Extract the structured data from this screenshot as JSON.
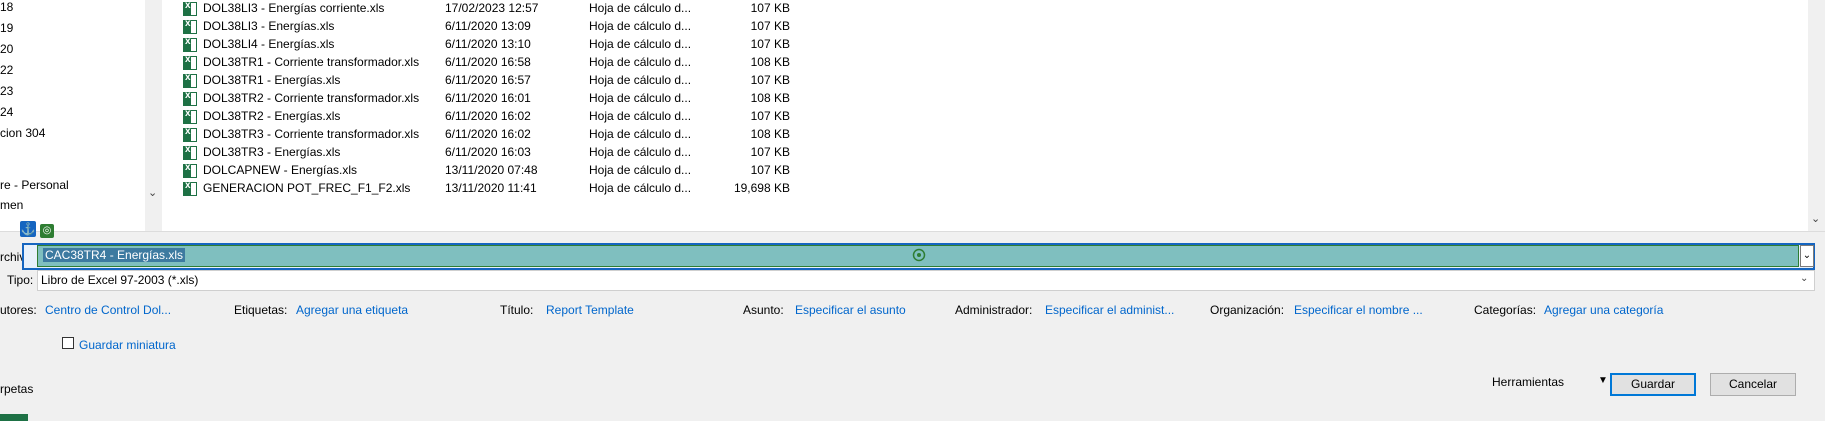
{
  "nav": {
    "items": [
      "18",
      "19",
      "20",
      "22",
      "23",
      "24",
      "cion 304",
      "re - Personal",
      "men"
    ]
  },
  "files": [
    {
      "name": "DOL38LI3 - Energías corriente.xls",
      "date": "17/02/2023 12:57",
      "type": "Hoja de cálculo d...",
      "size": "107 KB"
    },
    {
      "name": "DOL38LI3 - Energías.xls",
      "date": "6/11/2020 13:09",
      "type": "Hoja de cálculo d...",
      "size": "107 KB"
    },
    {
      "name": "DOL38LI4 - Energías.xls",
      "date": "6/11/2020 13:10",
      "type": "Hoja de cálculo d...",
      "size": "107 KB"
    },
    {
      "name": "DOL38TR1 - Corriente transformador.xls",
      "date": "6/11/2020 16:58",
      "type": "Hoja de cálculo d...",
      "size": "108 KB"
    },
    {
      "name": "DOL38TR1 - Energías.xls",
      "date": "6/11/2020 16:57",
      "type": "Hoja de cálculo d...",
      "size": "107 KB"
    },
    {
      "name": "DOL38TR2 - Corriente transformador.xls",
      "date": "6/11/2020 16:01",
      "type": "Hoja de cálculo d...",
      "size": "108 KB"
    },
    {
      "name": "DOL38TR2 - Energías.xls",
      "date": "6/11/2020 16:02",
      "type": "Hoja de cálculo d...",
      "size": "107 KB"
    },
    {
      "name": "DOL38TR3 - Corriente transformador.xls",
      "date": "6/11/2020 16:02",
      "type": "Hoja de cálculo d...",
      "size": "108 KB"
    },
    {
      "name": "DOL38TR3 - Energías.xls",
      "date": "6/11/2020 16:03",
      "type": "Hoja de cálculo d...",
      "size": "107 KB"
    },
    {
      "name": "DOLCAPNEW - Energías.xls",
      "date": "13/11/2020 07:48",
      "type": "Hoja de cálculo d...",
      "size": "107 KB"
    },
    {
      "name": "GENERACION POT_FREC_F1_F2.xls",
      "date": "13/11/2020 11:41",
      "type": "Hoja de cálculo d...",
      "size": "19,698 KB"
    }
  ],
  "filename": {
    "label": "rchivo:",
    "value": "CAC38TR4 - Energías.xls"
  },
  "filetype": {
    "label": "Tipo:",
    "value": "Libro de Excel 97-2003 (*.xls)"
  },
  "meta": {
    "autores_label": "utores:",
    "autores_value": "Centro de Control Dol...",
    "etiquetas_label": "Etiquetas:",
    "etiquetas_value": "Agregar una etiqueta",
    "titulo_label": "Título:",
    "titulo_value": "Report Template",
    "asunto_label": "Asunto:",
    "asunto_value": "Especificar el asunto",
    "admin_label": "Administrador:",
    "admin_value": "Especificar el administ...",
    "org_label": "Organización:",
    "org_value": "Especificar el nombre ...",
    "cat_label": "Categorías:",
    "cat_value": "Agregar una categoría"
  },
  "thumbnail": {
    "label": "Guardar miniatura",
    "checked": false
  },
  "footer": {
    "folders_label": "rpetas",
    "tools_label": "Herramientas",
    "save_label": "Guardar",
    "cancel_label": "Cancelar"
  },
  "icons": {
    "file": "excel-file-icon",
    "anchor": "anchor-icon",
    "target": "target-icon",
    "dropdown": "chevron-down-icon"
  },
  "colors": {
    "link": "#0066cc",
    "excel_green": "#1e7145",
    "focus_blue": "#1565c0",
    "selection_teal": "#7fbfbf"
  }
}
